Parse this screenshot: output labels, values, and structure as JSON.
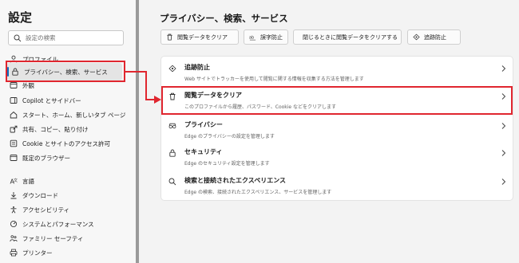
{
  "sidebar": {
    "title": "設定",
    "search_placeholder": "設定の検索",
    "items": [
      {
        "label": "プロファイル",
        "icon": "profile-icon"
      },
      {
        "label": "プライバシー、検索、サービス",
        "icon": "lock-icon",
        "selected": true
      },
      {
        "label": "外観",
        "icon": "appearance-icon"
      },
      {
        "label": "Copilot とサイドバー",
        "icon": "sidebar-icon"
      },
      {
        "label": "スタート、ホーム、新しいタブ ページ",
        "icon": "home-icon"
      },
      {
        "label": "共有、コピー、貼り付け",
        "icon": "share-icon"
      },
      {
        "label": "Cookie とサイトのアクセス許可",
        "icon": "cookie-icon"
      },
      {
        "label": "既定のブラウザー",
        "icon": "browser-icon"
      },
      {
        "label": "言語",
        "icon": "language-icon"
      },
      {
        "label": "ダウンロード",
        "icon": "download-icon"
      },
      {
        "label": "アクセシビリティ",
        "icon": "accessibility-icon"
      },
      {
        "label": "システムとパフォーマンス",
        "icon": "system-icon"
      },
      {
        "label": "ファミリー セーフティ",
        "icon": "family-icon"
      },
      {
        "label": "プリンター",
        "icon": "printer-icon"
      }
    ]
  },
  "main": {
    "title": "プライバシー、検索、サービス",
    "actions": [
      {
        "label": "閲覧データをクリア",
        "icon": "trash-icon"
      },
      {
        "label": "誤字防止",
        "icon": "typo-icon"
      },
      {
        "label": "閉じるときに閲覧データをクリアする",
        "icon": "trash-clock-icon"
      },
      {
        "label": "追跡防止",
        "icon": "tracking-icon"
      }
    ],
    "rows": [
      {
        "title": "追跡防止",
        "desc": "Web サイトでトラッカーを使用して閲覧に関する情報を収集する方法を管理します",
        "icon": "tracking-icon"
      },
      {
        "title": "閲覧データをクリア",
        "desc": "このプロファイルから履歴、パスワード、Cookie などをクリアします",
        "icon": "trash-icon"
      },
      {
        "title": "プライバシー",
        "desc": "Edge のプライバシーの設定を管理します",
        "icon": "glasses-icon"
      },
      {
        "title": "セキュリティ",
        "desc": "Edge のセキュリティ設定を管理します",
        "icon": "lock-icon"
      },
      {
        "title": "検索と接続されたエクスペリエンス",
        "desc": "Edge の検索、接続されたエクスペリエンス、サービスを管理します",
        "icon": "search-icon"
      }
    ]
  },
  "colors": {
    "accent": "#0f6cbd",
    "highlight": "#e0262f"
  }
}
